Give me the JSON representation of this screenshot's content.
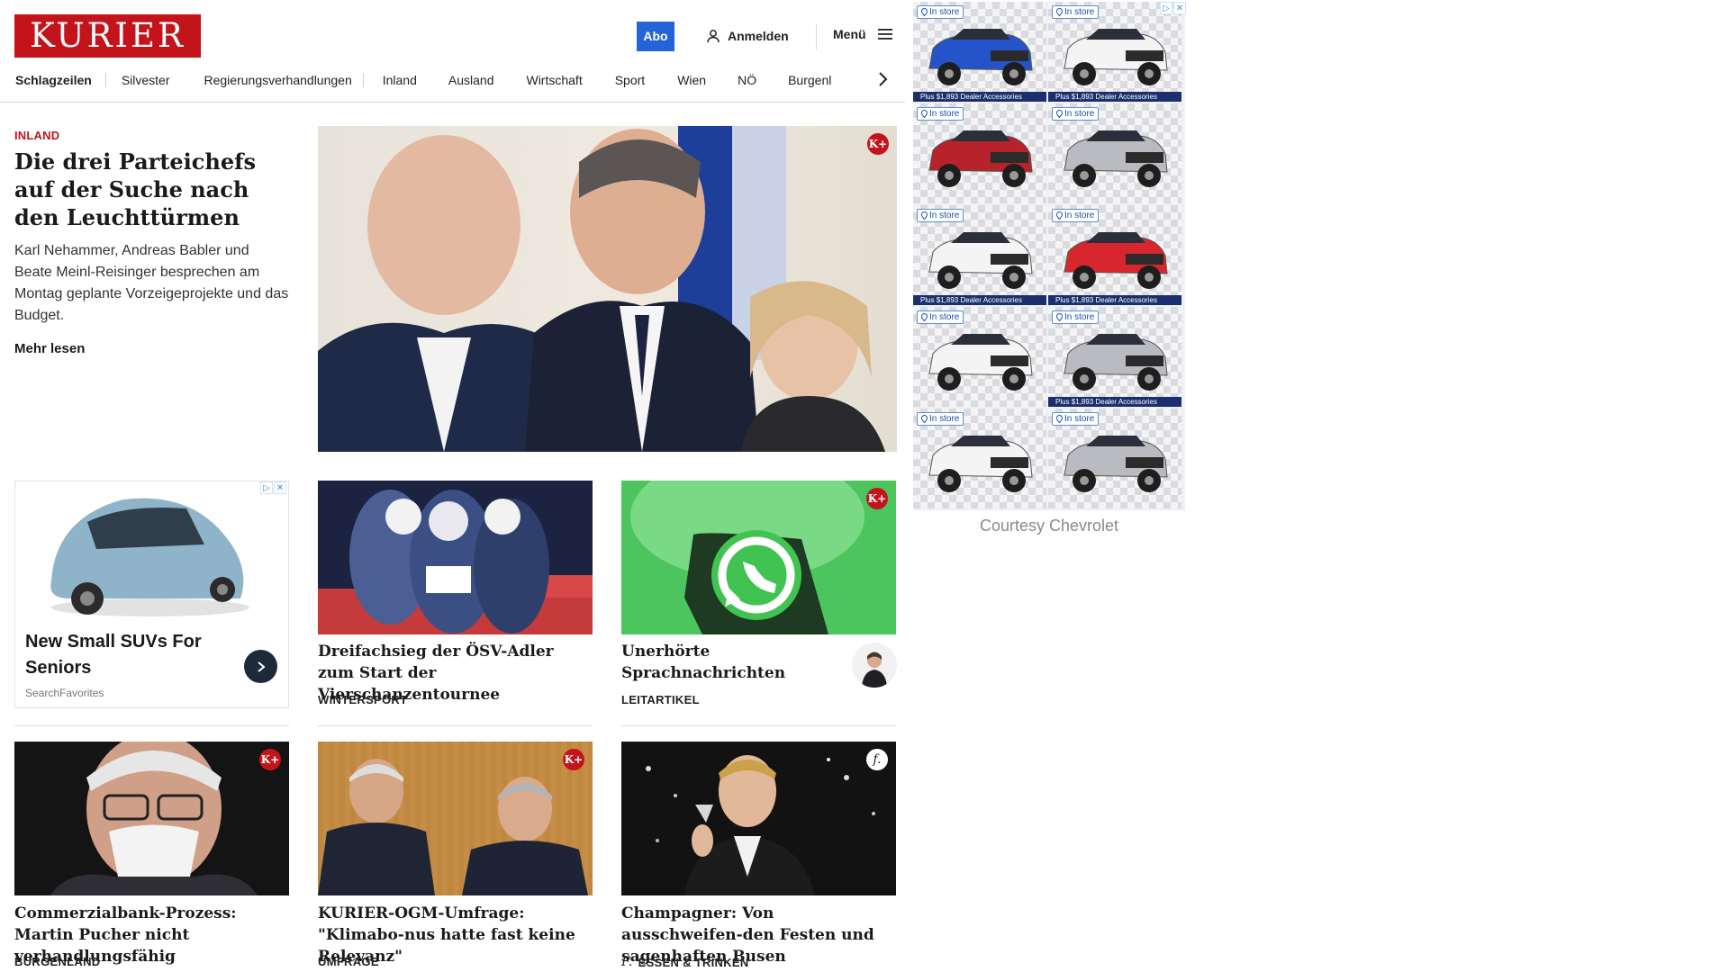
{
  "header": {
    "logo_text": "KURIER",
    "abo_label": "Abo",
    "login_label": "Anmelden",
    "menu_label": "Menü"
  },
  "nav": {
    "items": [
      "Schlagzeilen",
      "Silvester",
      "Regierungsverhandlungen",
      "Inland",
      "Ausland",
      "Wirtschaft",
      "Sport",
      "Wien",
      "NÖ",
      "Burgenl"
    ]
  },
  "hero": {
    "kicker": "INLAND",
    "title": "Die drei Parteichefs auf der Suche nach den Leuchttürmen",
    "teaser": "Karl Nehammer, Andreas Babler und Beate Meinl-Reisinger besprechen am Montag geplante Vorzeigeprojekte und das Budget.",
    "more_label": "Mehr lesen",
    "badge": "K+"
  },
  "ad_card": {
    "title": "New Small SUVs For Seniors",
    "source": "SearchFavorites"
  },
  "cards": [
    {
      "title": "Dreifachsieg der ÖSV-Adler zum Start der Vierschanzentournee",
      "category": "WINTERSPORT"
    },
    {
      "title": "Unerhörte Sprachnachrichten",
      "category": "LEITARTIKEL",
      "badge": "K+"
    },
    {
      "title": "Commerzialbank-Prozess: Martin Pucher nicht verhandlungsfähig",
      "category": "BURGENLAND",
      "badge": "K+"
    },
    {
      "title": "KURIER-OGM-Umfrage: \"Klimabo-nus hatte fast keine Relevanz\"",
      "category": "UMFRAGE",
      "badge": "K+"
    },
    {
      "title": "Champagner: Von ausschweifen-den Festen und sagenhaften Busen",
      "category": "ESSEN & TRINKEN",
      "badge": "f."
    }
  ],
  "side_ad": {
    "tiles": [
      {
        "badge": "In store",
        "strip": "Plus $1,893 Dealer Accessories",
        "color": "#2553c9"
      },
      {
        "badge": "In store",
        "strip": "Plus $1,893 Dealer Accessories",
        "color": "#f4f4f4"
      },
      {
        "badge": "In store",
        "strip": "",
        "color": "#b8222a"
      },
      {
        "badge": "In store",
        "strip": "",
        "color": "#b9bbc0"
      },
      {
        "badge": "In store",
        "strip": "Plus $1,893 Dealer Accessories",
        "color": "#f4f4f4"
      },
      {
        "badge": "In store",
        "strip": "Plus $1,893 Dealer Accessories",
        "color": "#d8262e"
      },
      {
        "badge": "In store",
        "strip": "",
        "color": "#f4f4f4"
      },
      {
        "badge": "In store",
        "strip": "Plus $1,893 Dealer Accessories",
        "color": "#b9bbc0"
      },
      {
        "badge": "In store",
        "strip": "",
        "color": "#f4f4f4"
      },
      {
        "badge": "In store",
        "strip": "",
        "color": "#b9bbc0"
      }
    ],
    "courtesy": "Courtesy Chevrolet"
  },
  "colors": {
    "brand": "#c4141b",
    "abo": "#2563d9"
  }
}
